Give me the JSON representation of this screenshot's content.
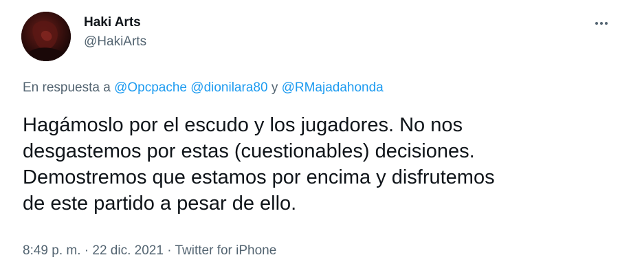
{
  "author": {
    "display_name": "Haki Arts",
    "handle": "@HakiArts",
    "avatar_icon": "avatar-image"
  },
  "more_icon": "more-horizontal-icon",
  "reply_context": {
    "prefix": "En respuesta a",
    "mentions": [
      "@Opcpache",
      "@dionilara80",
      "@RMajadahonda"
    ],
    "conjunction": "y"
  },
  "tweet_text": {
    "lines": [
      "Hagámoslo por el escudo y los jugadores. No nos",
      "desgastemos por estas (cuestionables) decisiones.",
      "Demostremos que estamos por encima y disfrutemos",
      "de este partido a pesar de ello."
    ]
  },
  "meta": {
    "time": "8:49 p. m.",
    "separator": "·",
    "date": "22 dic. 2021",
    "source": "Twitter for iPhone"
  },
  "colors": {
    "text": "#0f1419",
    "secondary": "#536471",
    "link": "#1d9bf0"
  }
}
